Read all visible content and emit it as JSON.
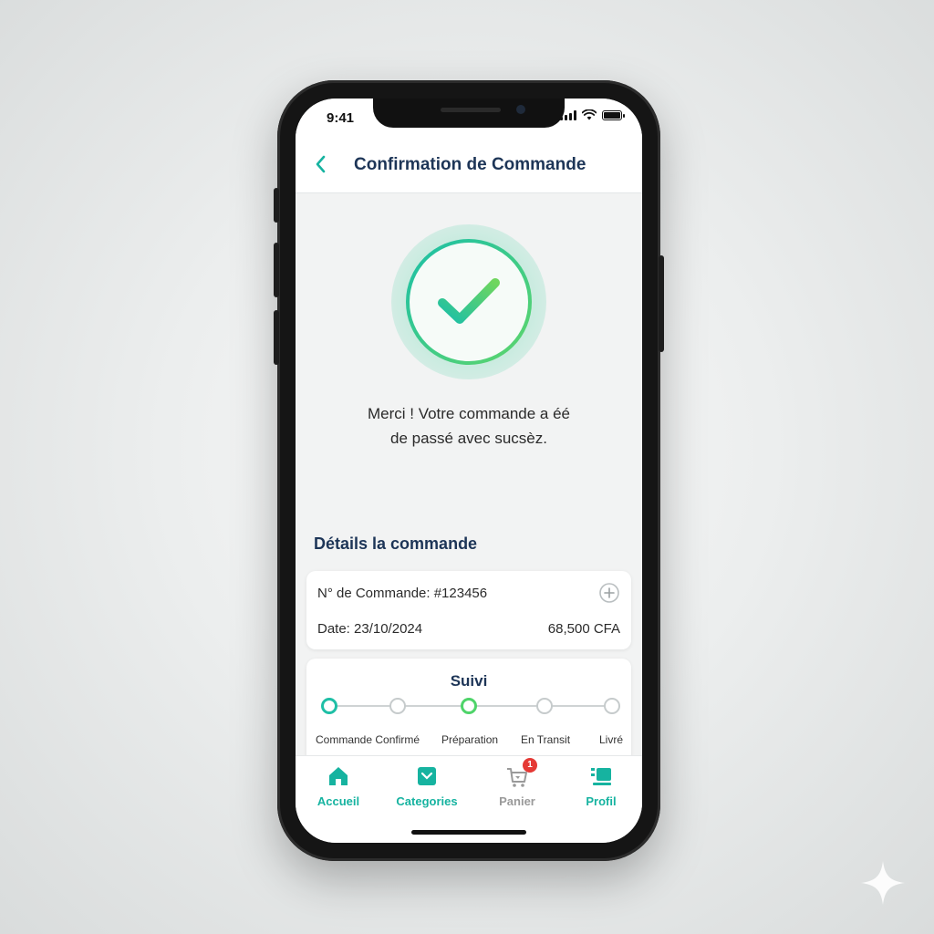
{
  "status_bar": {
    "time": "9:41"
  },
  "header": {
    "title": "Confirmation de Commande"
  },
  "message": {
    "line1": "Merci ! Votre commande a éé",
    "line2": "de passé avec sucsèz."
  },
  "details": {
    "section_title": "Détails la commande",
    "order_number": "N° de Commande: #123456",
    "date": "Date: 23/10/2024",
    "total": "68,500 CFA"
  },
  "tracking": {
    "title": "Suivi",
    "steps": [
      {
        "label": "Commande Confirmé",
        "state": "done"
      },
      {
        "label": "",
        "state": "pending"
      },
      {
        "label": "Préparation",
        "state": "current"
      },
      {
        "label": "En Transit",
        "state": "pending"
      },
      {
        "label": "Livré",
        "state": "pending"
      }
    ]
  },
  "tabbar": {
    "items": [
      {
        "label": "Accueil",
        "icon": "home-icon",
        "color": "#16b3a0"
      },
      {
        "label": "Categories",
        "icon": "categories-icon",
        "color": "#16b3a0"
      },
      {
        "label": "Panier",
        "icon": "cart-icon",
        "color": "#9a9a9a",
        "badge": "1"
      },
      {
        "label": "Profil",
        "icon": "profile-icon",
        "color": "#16b3a0"
      }
    ]
  },
  "colors": {
    "accent": "#16b3a0",
    "success_green": "#4fd46a",
    "title_navy": "#1d3557",
    "badge_red": "#e53935"
  }
}
